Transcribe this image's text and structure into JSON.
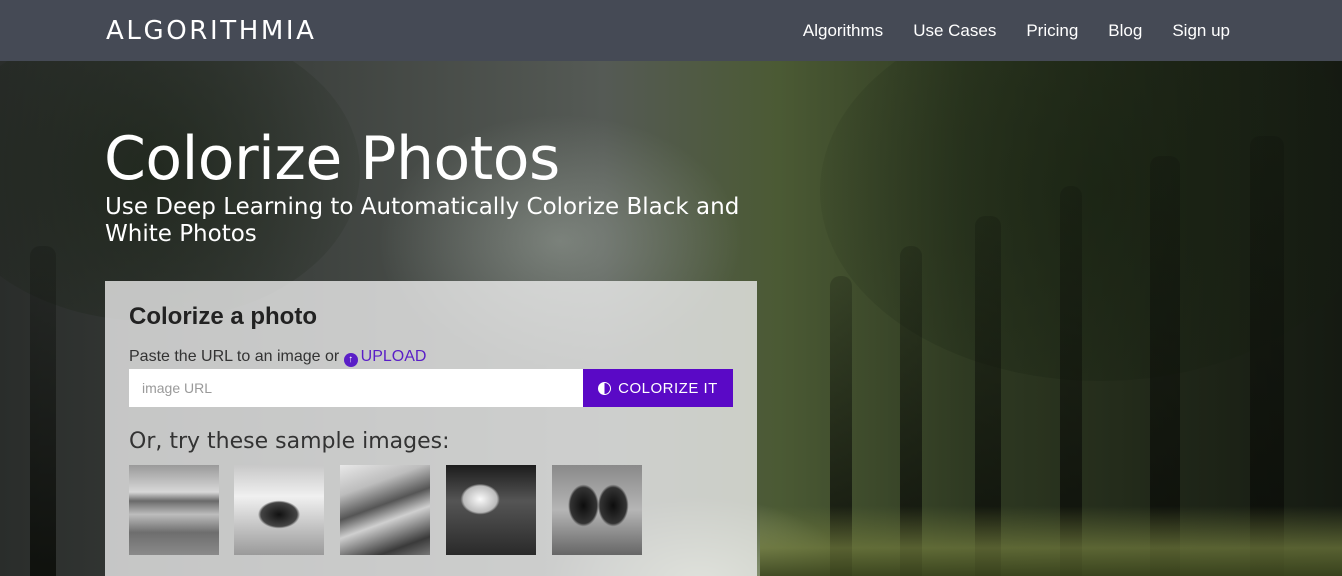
{
  "nav": {
    "logo": "ALGORITHMIA",
    "links": [
      "Algorithms",
      "Use Cases",
      "Pricing",
      "Blog",
      "Sign up"
    ]
  },
  "hero": {
    "title": "Colorize Photos",
    "subtitle": "Use Deep Learning to Automatically Colorize Black and White Photos"
  },
  "panel": {
    "title": "Colorize a photo",
    "instructions_prefix": "Paste the URL to an image or",
    "upload_label": "UPLOAD",
    "url_input_placeholder": "image URL",
    "url_input_value": "",
    "colorize_button_label": "COLORIZE IT",
    "samples_heading": "Or, try these sample images:",
    "samples": [
      "bird-on-beach",
      "race-car",
      "mountain",
      "woman-with-cloth",
      "cows"
    ]
  },
  "colors": {
    "navbar_bg": "#454a55",
    "accent": "#5a09c6",
    "upload_link": "#5a1ec7"
  }
}
